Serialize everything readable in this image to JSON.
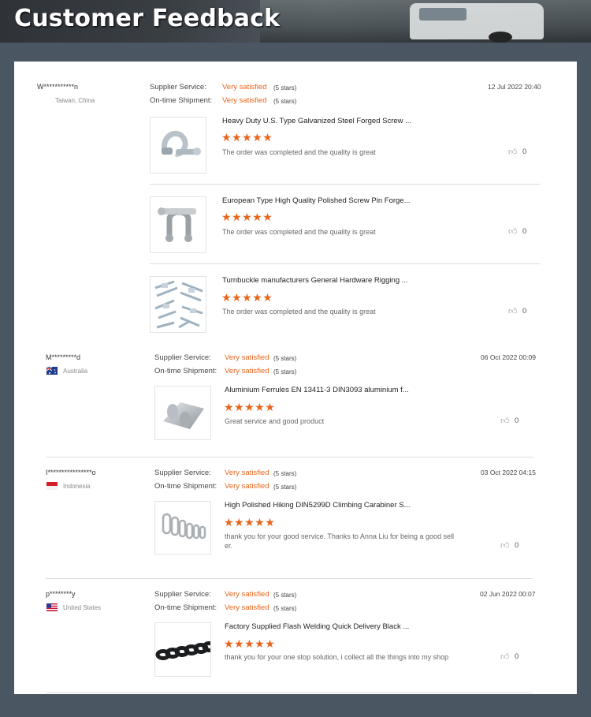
{
  "banner": {
    "title": "Customer Feedback"
  },
  "labels": {
    "supplier_service": "Supplier Service:",
    "on_time_shipment": "On-time Shipment:",
    "stars_glyphs": "★★★★★"
  },
  "reviews": [
    {
      "user": "W***********n",
      "country": "Taiwan, China",
      "date": "12 Jul 2022 20:40",
      "supplier_rating": "Very satisfied",
      "supplier_stars": "(5 stars)",
      "shipment_rating": "Very satisfied",
      "shipment_stars": "(5 stars)",
      "items": [
        {
          "title": "Heavy Duty U.S. Type Galvanized Steel Forged Screw ...",
          "comment": "The order was completed and the quality is great",
          "likes": "0",
          "thumb": "shackle-galvanized"
        },
        {
          "title": "European Type High Quality Polished Screw Pin Forge...",
          "comment": "The order was completed and the quality is great",
          "likes": "0",
          "thumb": "shackle-polished"
        },
        {
          "title": "Turnbuckle manufacturers General Hardware Rigging ...",
          "comment": "The order was completed and the quality is great",
          "likes": "0",
          "thumb": "turnbuckles"
        }
      ]
    },
    {
      "user": "M*********d",
      "country": "Australia",
      "date": "06 Oct 2022 00:09",
      "supplier_rating": "Very satisfied",
      "supplier_stars": "(5 stars)",
      "shipment_rating": "Very satisfied",
      "shipment_stars": "(5 stars)",
      "items": [
        {
          "title": "Aluminium Ferrules EN 13411-3 DIN3093 aluminium f...",
          "comment": "Great service and good product",
          "likes": "0",
          "thumb": "ferrule"
        }
      ]
    },
    {
      "user": "I****************o",
      "country": "Indonesia",
      "date": "03 Oct 2022 04:15",
      "supplier_rating": "Very satisfied",
      "supplier_stars": "(5 stars)",
      "shipment_rating": "Very satisfied",
      "shipment_stars": "(5 stars)",
      "items": [
        {
          "title": "High Polished Hiking DIN5299D Climbing Carabiner S...",
          "comment_line1": "thank you for your good service. Thanks to Anna Liu for being a good sell",
          "comment_line2": "er.",
          "likes": "0",
          "thumb": "carabiners"
        }
      ]
    },
    {
      "user": "p********y",
      "country": "United States",
      "date": "02 Jun 2022 00:07",
      "supplier_rating": "Very satisfied",
      "supplier_stars": "(5 stars)",
      "shipment_rating": "Very satisfied",
      "shipment_stars": "(5 stars)",
      "items": [
        {
          "title": "Factory Supplied Flash Welding Quick Delivery Black ...",
          "comment": "thank you for your one stop solution, i collect all the things into my shop",
          "likes": "0",
          "thumb": "chain"
        }
      ]
    }
  ],
  "colors": {
    "accent": "#e8641b",
    "background": "#4b5663",
    "panel": "#ffffff"
  }
}
